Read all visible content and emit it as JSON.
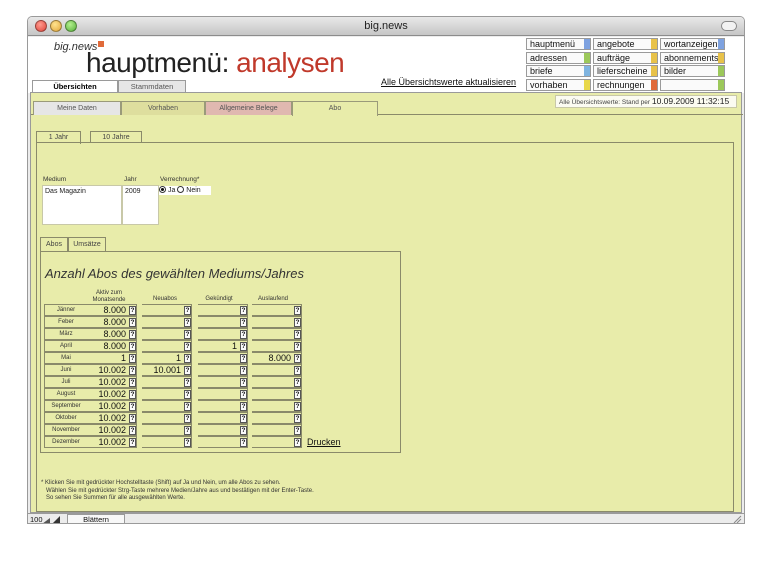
{
  "window": {
    "title": "big.news"
  },
  "header": {
    "logo": "big.news",
    "title_main": "hauptmenü:",
    "title_sub": "analysen",
    "update_link": "Alle Übersichtswerte aktualisieren"
  },
  "menu": [
    {
      "label": "hauptmenü",
      "color": "#7ea2e0"
    },
    {
      "label": "angebote",
      "color": "#e8c24a"
    },
    {
      "label": "wortanzeigen",
      "color": "#7ea2e0"
    },
    {
      "label": "adressen",
      "color": "#9cc85a"
    },
    {
      "label": "aufträge",
      "color": "#e8c24a"
    },
    {
      "label": "abonnements",
      "color": "#e8c24a"
    },
    {
      "label": "briefe",
      "color": "#7fb4e0"
    },
    {
      "label": "lieferscheine",
      "color": "#e8c24a"
    },
    {
      "label": "bilder",
      "color": "#9cc85a"
    },
    {
      "label": "vorhaben",
      "color": "#e8d84a"
    },
    {
      "label": "rechnungen",
      "color": "#e06a3a"
    },
    {
      "label": "",
      "color": "#9cc85a"
    }
  ],
  "main_tabs": [
    {
      "label": "Übersichten",
      "active": true
    },
    {
      "label": "Stammdaten",
      "active": false
    }
  ],
  "stand": {
    "prefix": "Alle Übersichtswerte: Stand per",
    "value": "10.09.2009 11:32:15"
  },
  "sub_tabs": [
    {
      "label": "Meine Daten",
      "color": "#e6e6e6"
    },
    {
      "label": "Vorhaben",
      "color": "#dede9e"
    },
    {
      "label": "Allgemeine Belege",
      "color": "#e0b8b0"
    },
    {
      "label": "Abo",
      "color": "#e8ecaa"
    }
  ],
  "year_tabs": [
    "1 Jahr",
    "10 Jahre"
  ],
  "fields": {
    "medium_label": "Medium",
    "jahr_label": "Jahr",
    "verrechnung_label": "Verrechnung*",
    "medium_value": "Das Magazin",
    "jahr_value": "2009",
    "radio_ja": "Ja",
    "radio_nein": "Nein"
  },
  "abos_tabs": [
    "Abos",
    "Umsätze"
  ],
  "abos": {
    "title": "Anzahl Abos des gewählten Mediums/Jahres",
    "columns": [
      "Aktiv zum Monatsende",
      "Neuabos",
      "Gekündigt",
      "Auslaufend"
    ],
    "rows": [
      {
        "month": "Jänner",
        "values": [
          "8.000",
          "",
          "",
          ""
        ]
      },
      {
        "month": "Feber",
        "values": [
          "8.000",
          "",
          "",
          ""
        ]
      },
      {
        "month": "März",
        "values": [
          "8.000",
          "",
          "",
          ""
        ]
      },
      {
        "month": "April",
        "values": [
          "8.000",
          "",
          "1",
          ""
        ]
      },
      {
        "month": "Mai",
        "values": [
          "1",
          "1",
          "",
          "8.000"
        ]
      },
      {
        "month": "Juni",
        "values": [
          "10.002",
          "10.001",
          "",
          ""
        ]
      },
      {
        "month": "Juli",
        "values": [
          "10.002",
          "",
          "",
          ""
        ]
      },
      {
        "month": "August",
        "values": [
          "10.002",
          "",
          "",
          ""
        ]
      },
      {
        "month": "September",
        "values": [
          "10.002",
          "",
          "",
          ""
        ]
      },
      {
        "month": "Oktober",
        "values": [
          "10.002",
          "",
          "",
          ""
        ]
      },
      {
        "month": "November",
        "values": [
          "10.002",
          "",
          "",
          ""
        ]
      },
      {
        "month": "Dezember",
        "values": [
          "10.002",
          "",
          "",
          ""
        ]
      }
    ],
    "qmark": "?",
    "print": "Drucken"
  },
  "footnote": "* Klicken Sie mit gedrückter Hochstelltaste (Shift) auf Ja und Nein, um alle Abos zu sehen.\n   Wählen Sie mit gedrückter Strg-Taste mehrere Medien/Jahre aus und bestätigen mit der Enter-Taste.\n   So sehen Sie Summen für alle ausgewählten Werte.",
  "status": {
    "zoom": "100",
    "mode": "Blättern"
  }
}
